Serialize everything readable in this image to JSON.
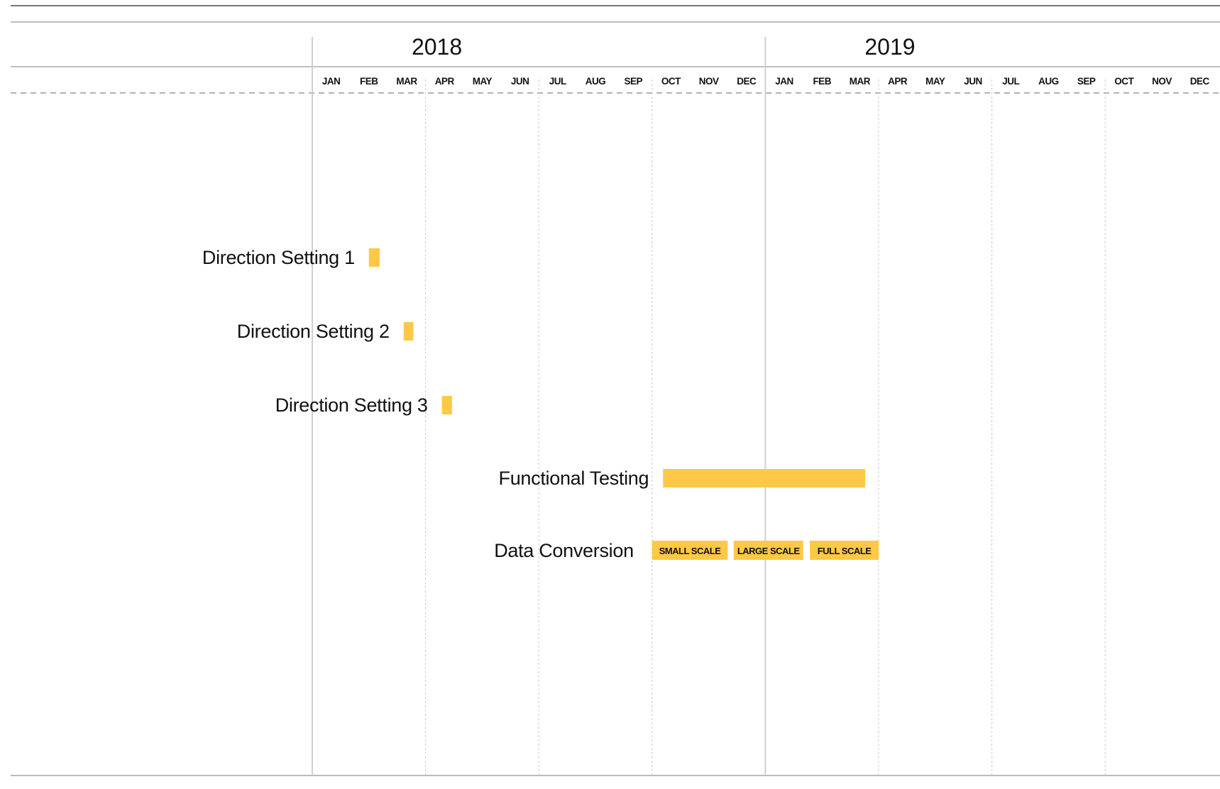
{
  "chart_data": {
    "type": "gantt",
    "years": [
      "2018",
      "2019"
    ],
    "months": [
      "JAN",
      "FEB",
      "MAR",
      "APR",
      "MAY",
      "JUN",
      "JUL",
      "AUG",
      "SEP",
      "OCT",
      "NOV",
      "DEC",
      "JAN",
      "FEB",
      "MAR",
      "APR",
      "MAY",
      "JUN",
      "JUL",
      "AUG",
      "SEP",
      "OCT",
      "NOV",
      "DEC"
    ],
    "x_range": [
      "2018-01",
      "2019-12"
    ],
    "grid": "quarterly dotted lines, solid year separators",
    "bar_color": "#FFC846",
    "tasks": [
      {
        "label": "Direction Setting 1",
        "start": "2018-02-15",
        "end": "2018-02-22"
      },
      {
        "label": "Direction Setting 2",
        "start": "2018-03-14",
        "end": "2018-03-21"
      },
      {
        "label": "Direction Setting 3",
        "start": "2018-04-14",
        "end": "2018-04-21"
      },
      {
        "label": "Functional Testing",
        "start": "2018-10-10",
        "end": "2019-03-20"
      },
      {
        "label": "Data Conversion",
        "segments": [
          {
            "label": "SMALL SCALE",
            "start": "2018-10-01",
            "end": "2018-11-30"
          },
          {
            "label": "LARGE SCALE",
            "start": "2018-12-06",
            "end": "2019-01-31"
          },
          {
            "label": "FULL SCALE",
            "start": "2019-02-06",
            "end": "2019-03-31"
          }
        ]
      }
    ]
  }
}
